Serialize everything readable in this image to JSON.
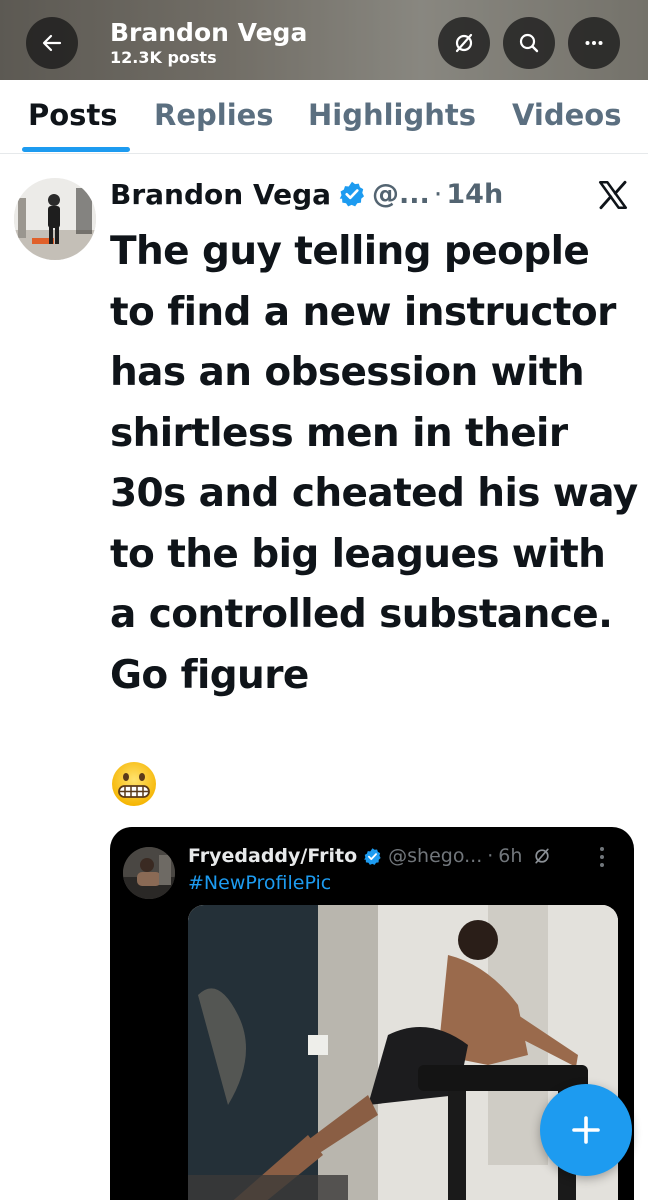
{
  "header": {
    "name": "Brandon Vega",
    "post_count": "12.3K posts",
    "icons": [
      "back-arrow-icon",
      "grok-icon",
      "search-icon",
      "more-icon"
    ]
  },
  "tabs": [
    {
      "label": "Posts",
      "active": true
    },
    {
      "label": "Replies",
      "active": false
    },
    {
      "label": "Highlights",
      "active": false
    },
    {
      "label": "Videos",
      "active": false
    }
  ],
  "post": {
    "author": "Brandon Vega",
    "handle": "@...",
    "separator": "·",
    "time": "14h",
    "text": "The guy telling people to find a new instructor has an obsession with shirtless men in their 30s and cheated his way to the big leagues with a controlled substance. Go figure",
    "emoji": "grimacing-face-emoji"
  },
  "quote": {
    "author": "Fryedaddy/Frito",
    "handle": "@shego...",
    "separator": "·",
    "time": "6h",
    "hashtag": "#NewProfilePic"
  },
  "colors": {
    "accent": "#1d9bf0",
    "text": "#0f1419",
    "muted": "#536471",
    "card_bg": "#000000"
  }
}
